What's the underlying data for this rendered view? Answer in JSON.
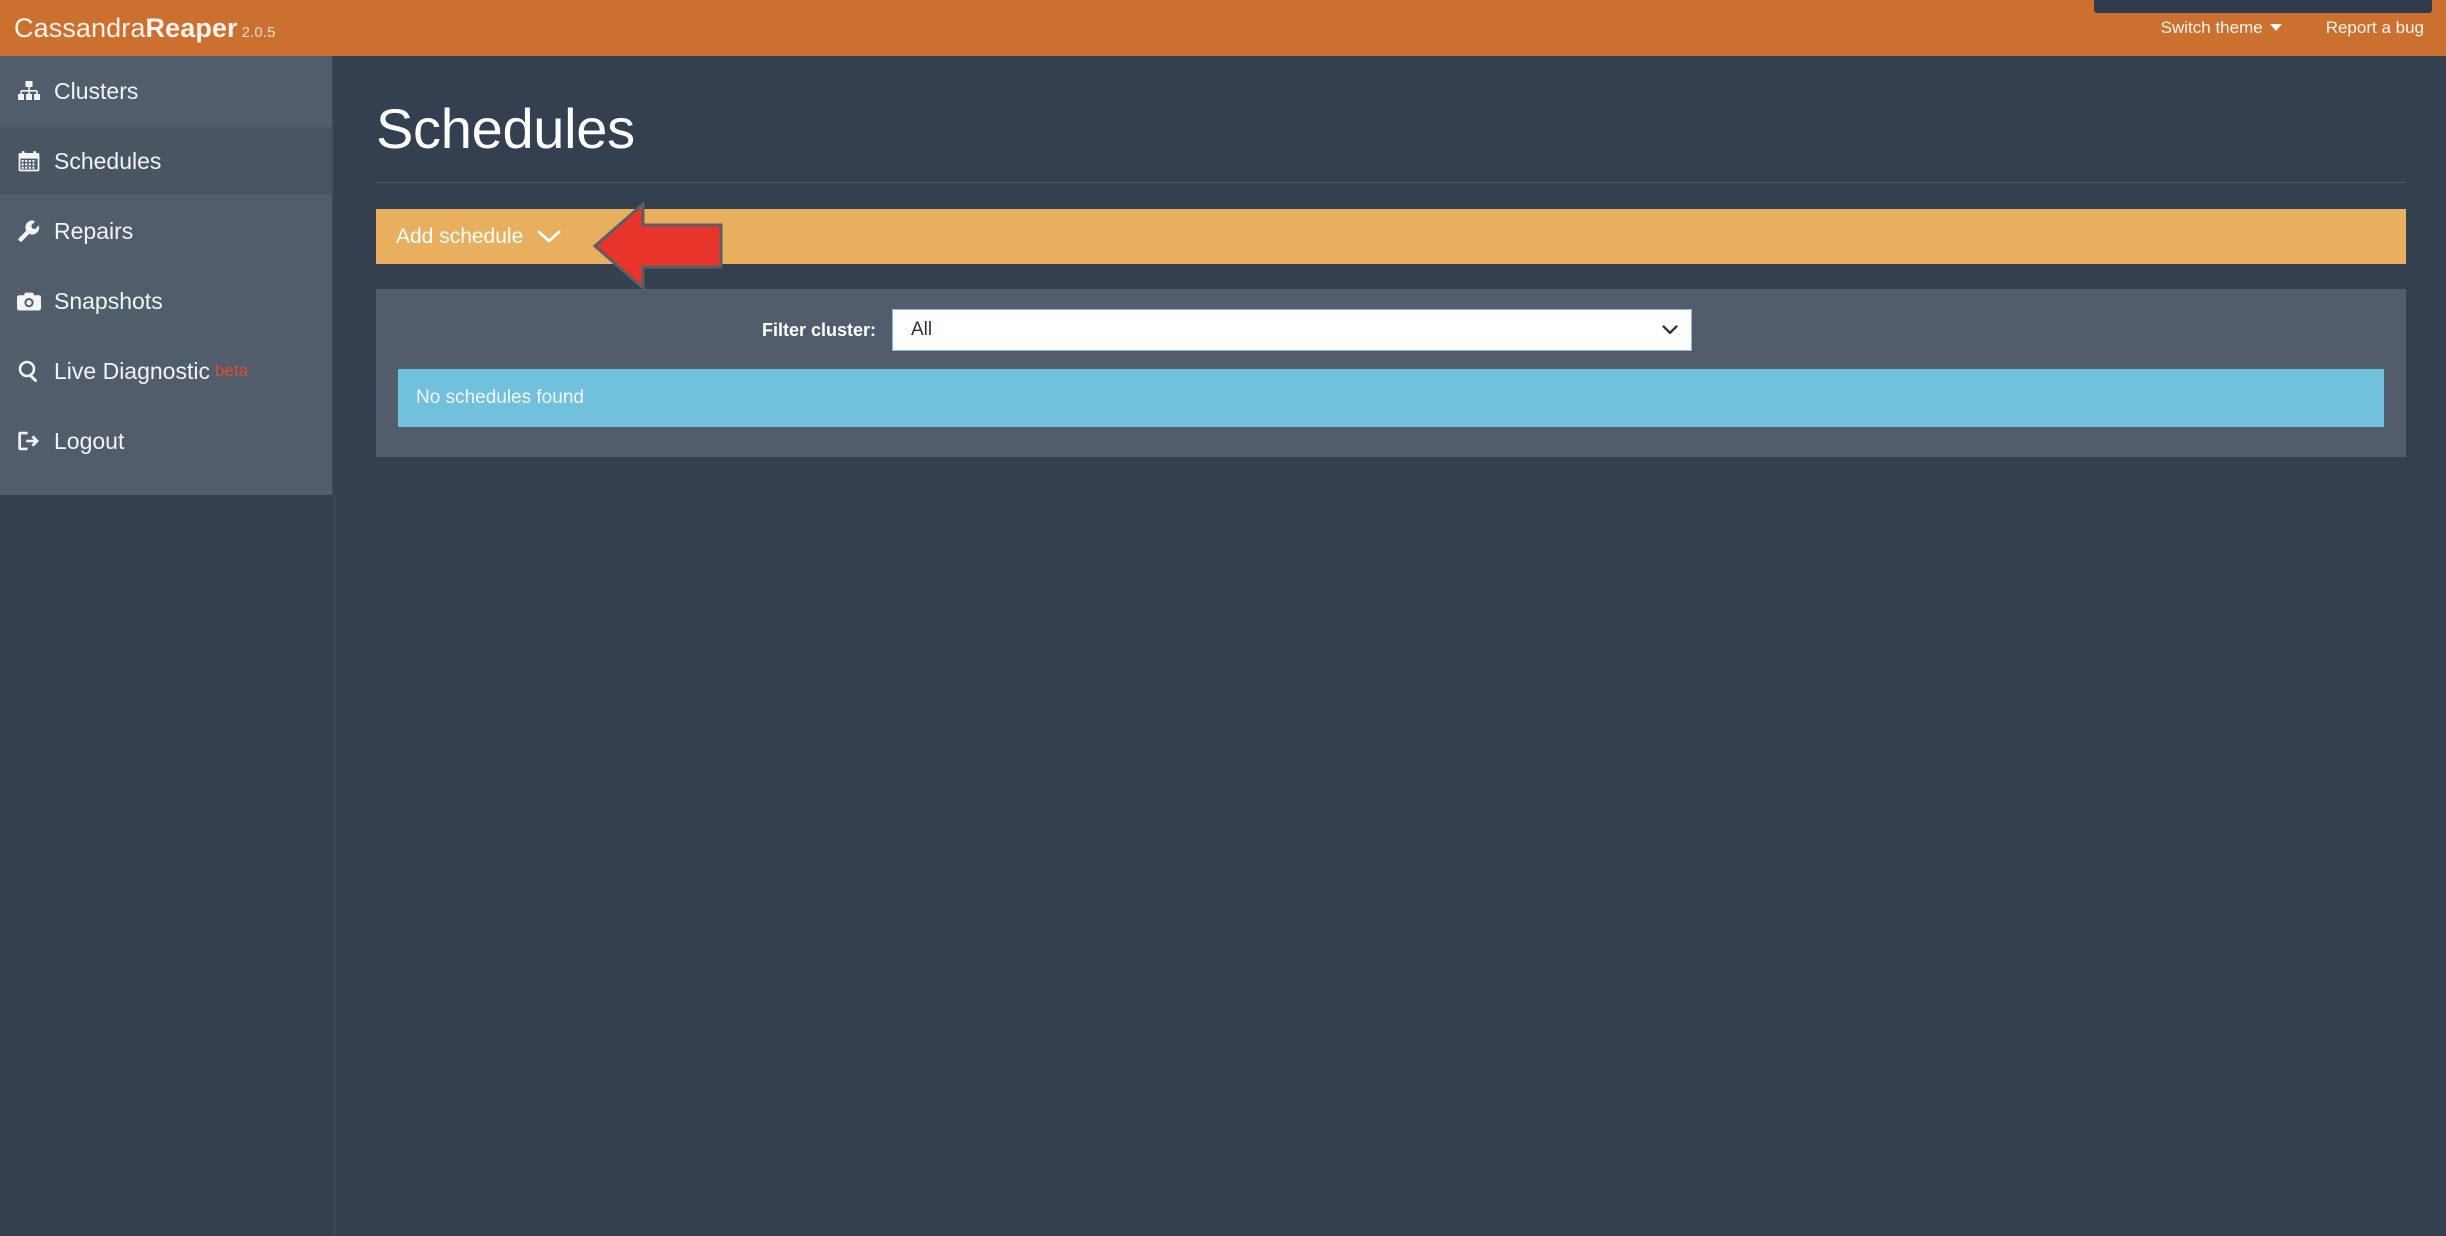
{
  "navbar": {
    "brand_prefix": "Cassandra",
    "brand_strong": "Reaper",
    "brand_version": "2.0.5",
    "switch_theme_label": "Switch theme",
    "report_bug_label": "Report a bug",
    "background_color": "#CC7030"
  },
  "sidebar": {
    "background_color": "#515D6B",
    "active_background_color": "#4A5562",
    "items": [
      {
        "label": "Clusters",
        "icon": "sitemap-icon",
        "active": false
      },
      {
        "label": "Schedules",
        "icon": "calendar-icon",
        "active": true
      },
      {
        "label": "Repairs",
        "icon": "wrench-icon",
        "active": false
      },
      {
        "label": "Snapshots",
        "icon": "camera-icon",
        "active": false
      },
      {
        "label": "Live Diagnostic",
        "icon": "search-icon",
        "active": false,
        "badge": "beta",
        "badge_color": "#E04B32"
      },
      {
        "label": "Logout",
        "icon": "sign-out-icon",
        "active": false
      }
    ]
  },
  "main": {
    "page_title": "Schedules",
    "add_schedule": {
      "label": "Add schedule",
      "icon": "chevron-down-icon",
      "background_color": "#E8B05E",
      "expanded": false
    },
    "filter": {
      "label": "Filter cluster:",
      "select_value": "All",
      "select_options": [
        "All"
      ],
      "select_icon": "chevron-down-icon"
    },
    "alert": {
      "message": "No schedules found",
      "background_color": "#71C0DC"
    }
  },
  "annotation": {
    "arrow_direction": "left",
    "arrow_color": "#E8342A",
    "arrow_outline_color": "#5A5F63",
    "points_at": "Add schedule"
  }
}
